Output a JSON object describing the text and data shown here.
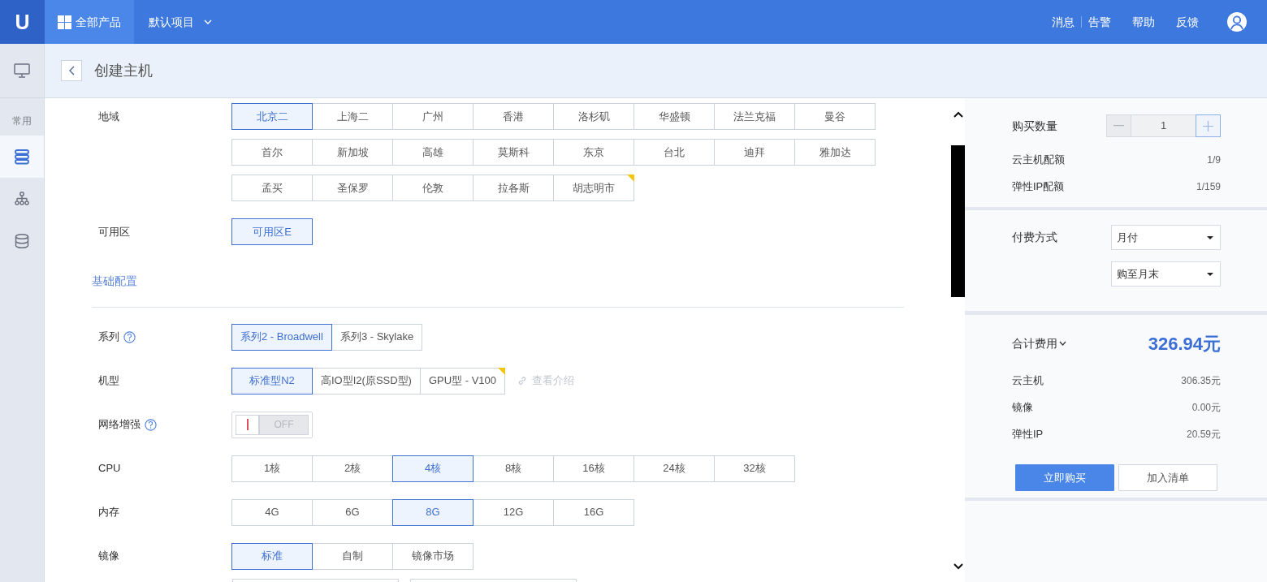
{
  "topbar": {
    "logo": "U",
    "products": "全部产品",
    "project": "默认项目",
    "links": [
      {
        "label": "消息"
      },
      {
        "label": "告警"
      },
      {
        "label": "帮助"
      },
      {
        "label": "反馈"
      }
    ]
  },
  "sidebar": {
    "top_item": {
      "selected": false
    },
    "section_label": "常用",
    "items": [
      {
        "selected": true
      },
      {
        "selected": false
      },
      {
        "selected": false
      }
    ]
  },
  "page_header": {
    "title": "创建主机"
  },
  "location": [
    {
      "label": "地域",
      "options": [
        {
          "label": "北京二",
          "selected": true,
          "marked": false
        },
        {
          "label": "上海二",
          "selected": false,
          "marked": false
        },
        {
          "label": "广州",
          "selected": false,
          "marked": false
        },
        {
          "label": "香港",
          "selected": false,
          "marked": false
        },
        {
          "label": "洛杉矶",
          "selected": false,
          "marked": false
        },
        {
          "label": "华盛顿",
          "selected": false,
          "marked": false
        },
        {
          "label": "法兰克福",
          "selected": false,
          "marked": false
        },
        {
          "label": "曼谷",
          "selected": false,
          "marked": false
        },
        {
          "label": "首尔",
          "selected": false,
          "marked": false
        },
        {
          "label": "新加坡",
          "selected": false,
          "marked": false
        },
        {
          "label": "高雄",
          "selected": false,
          "marked": false
        },
        {
          "label": "莫斯科",
          "selected": false,
          "marked": false
        },
        {
          "label": "东京",
          "selected": false,
          "marked": false
        },
        {
          "label": "台北",
          "selected": false,
          "marked": false
        },
        {
          "label": "迪拜",
          "selected": false,
          "marked": false
        },
        {
          "label": "雅加达",
          "selected": false,
          "marked": false
        },
        {
          "label": "孟买",
          "selected": false,
          "marked": false
        },
        {
          "label": "圣保罗",
          "selected": false,
          "marked": false
        },
        {
          "label": "伦敦",
          "selected": false,
          "marked": false
        },
        {
          "label": "拉各斯",
          "selected": false,
          "marked": false
        },
        {
          "label": "胡志明市",
          "selected": false,
          "marked": true
        }
      ]
    },
    {
      "label": "可用区",
      "options": [
        {
          "label": "可用区E",
          "selected": true
        }
      ]
    }
  ],
  "section_title": "基础配置",
  "config": [
    {
      "kind": "options",
      "label": "系列",
      "help": true,
      "options": [
        {
          "label": "系列2 - Broadwell",
          "selected": true
        },
        {
          "label": "系列3 - Skylake",
          "selected": false
        }
      ]
    },
    {
      "kind": "options",
      "label": "机型",
      "help": false,
      "options": [
        {
          "label": "标准型N2",
          "selected": true,
          "marked": false
        },
        {
          "label": "高IO型I2(原SSD型)",
          "selected": false,
          "marked": false
        },
        {
          "label": "GPU型 - V100",
          "selected": false,
          "marked": true
        }
      ],
      "link": "查看介绍"
    },
    {
      "kind": "switch",
      "label": "网络增强",
      "help": true,
      "switch": {
        "on": false,
        "label": "OFF"
      }
    },
    {
      "kind": "options",
      "label": "CPU",
      "help": false,
      "options": [
        {
          "label": "1核",
          "selected": false
        },
        {
          "label": "2核",
          "selected": false
        },
        {
          "label": "4核",
          "selected": true
        },
        {
          "label": "8核",
          "selected": false
        },
        {
          "label": "16核",
          "selected": false
        },
        {
          "label": "24核",
          "selected": false
        },
        {
          "label": "32核",
          "selected": false
        }
      ]
    },
    {
      "kind": "options",
      "label": "内存",
      "help": false,
      "options": [
        {
          "label": "4G",
          "selected": false
        },
        {
          "label": "6G",
          "selected": false
        },
        {
          "label": "8G",
          "selected": true
        },
        {
          "label": "12G",
          "selected": false
        },
        {
          "label": "16G",
          "selected": false
        }
      ]
    },
    {
      "kind": "options",
      "label": "镜像",
      "help": false,
      "options": [
        {
          "label": "标准",
          "selected": true
        },
        {
          "label": "自制",
          "selected": false
        },
        {
          "label": "镜像市场",
          "selected": false
        }
      ],
      "dropdowns": [
        {
          "kind": "select"
        },
        {
          "kind": "select"
        }
      ]
    }
  ],
  "order_panel": {
    "quantity": {
      "label": "购买数量",
      "value": "1",
      "decrement_disabled": true
    },
    "quotas": [
      {
        "label": "云主机配额",
        "value": "1/9"
      },
      {
        "label": "弹性IP配额",
        "value": "1/159"
      }
    ],
    "billing": {
      "label": "付费方式",
      "selects": [
        {
          "value": "月付"
        },
        {
          "value": "购至月末"
        }
      ]
    },
    "total": {
      "label": "合计费用",
      "value": "326.94元"
    },
    "costs": [
      {
        "label": "云主机",
        "value": "306.35元"
      },
      {
        "label": "镜像",
        "value": "0.00元"
      },
      {
        "label": "弹性IP",
        "value": "20.59元"
      }
    ],
    "buttons": [
      {
        "label": "立即购买",
        "kind": "primary"
      },
      {
        "label": "加入清单",
        "kind": "secondary"
      }
    ]
  }
}
